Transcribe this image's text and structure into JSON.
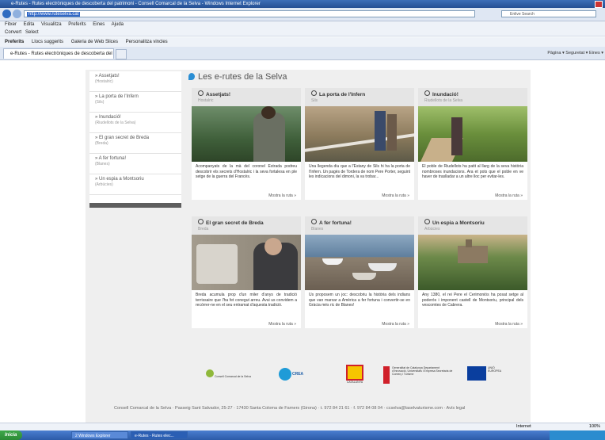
{
  "browser": {
    "title": "e-Rutes - Rutes electròniques de descoberta del patrimoni - Consell Comarcal de la Selva - Windows Internet Explorer",
    "address": "http://www.ruteselva.cat",
    "search_placeholder": "Enlive Search",
    "menu": [
      "Fitxer",
      "Edita",
      "Visualitza",
      "Preferits",
      "Eines",
      "Ajuda"
    ],
    "convert_label": "Convert",
    "select_label": "Select",
    "favorites_label": "Preferits",
    "fav_items": [
      "Llocs suggerits",
      "Galeria de Web Slices",
      "Personalitza vincles"
    ],
    "tab_label": "e-Rutes - Rutes electròniques de descoberta del patr...",
    "command_bar": "Pàgina ▾   Seguretat ▾   Eines ▾",
    "status_zone": "Internet",
    "status_zoom": "100%"
  },
  "sidebar": {
    "items": [
      {
        "title": "» Assetjats!",
        "sub": "(Hostalric)"
      },
      {
        "title": "» La porta de l'Infern",
        "sub": "(Sils)"
      },
      {
        "title": "» Inundació!",
        "sub": "(Riudellots de la Selva)"
      },
      {
        "title": "» El gran secret de Breda",
        "sub": "(Breda)"
      },
      {
        "title": "» A fer fortuna!",
        "sub": "(Blanes)"
      },
      {
        "title": "» Un espia a Montsoriu",
        "sub": "(Arbúcies)"
      }
    ]
  },
  "main": {
    "title": "Les e-rutes de la Selva",
    "cards": [
      {
        "title": "Assetjats!",
        "sub": "Hostalric",
        "desc": "Acompanyats de la mà del coronel Estrada podreu descobrir els secrets d'Hostalric i la seva fortalesa en ple setge de la guerra del Francès.",
        "more": "Mostra la ruta »"
      },
      {
        "title": "La porta de l'Infern",
        "sub": "Sils",
        "desc": "Una llegenda diu que a l'Estany de Sils hi ha la porta de l'Infern. Un pagès de Tordera de nom Pere Porter, seguint les indicacions del dimoni, la va trobar...",
        "more": "Mostra la ruta »"
      },
      {
        "title": "Inundació!",
        "sub": "Riudellots de la Selva",
        "desc": "El poble de Riudellots ha patit al llarg de la seva història nombroses inundacions. Ara et pots que el poble en ve haver de traslladar a un altre lloc per evitar-les.",
        "more": "Mostra la ruta »"
      },
      {
        "title": "El gran secret de Breda",
        "sub": "Breda",
        "desc": "Breda acumula prop d'un miler d'anys de tradició terrissaire que l'ha fet conegut arreu. Avui us convidem a recórrer-ne en el seu entramat d'aquesta tradició.",
        "more": "Mostra la ruta »"
      },
      {
        "title": "A fer fortuna!",
        "sub": "Blanes",
        "desc": "Us proposem un joc: descobriu la història dels indians que van marxar a Amèrica a fer fortuna i convertir-se en Gràcia més ric de Blanes!",
        "more": "Mostra la ruta »"
      },
      {
        "title": "Un espia a Montsoriu",
        "sub": "Arbúcies",
        "desc": "Any 1380, el rei Pere el Cerimoniós ha posat setge al poderós i imponent castell de Montsoriu, principal dels vescomtes de Cabrera.",
        "more": "Mostra la ruta »"
      }
    ]
  },
  "logos": [
    "Consell Comarcal de la Selva",
    "CREA",
    "CATALUNYA",
    "Generalitat de Catalunya Departament d'Innovació, Universitats i Empresa Secretaria de Comerç i Turisme",
    "UNIÓ EUROPEA"
  ],
  "footer": "Consell Comarcal de la Selva · Passeig Sant Salvador, 25-27 · 17430 Santa Coloma de Farners (Girona) · t. 972 84 21 61 · f. 972 84 08 04 · ccselva@laselvaturisme.com · Avís legal",
  "taskbar": {
    "start": "Inicia",
    "items": [
      "2 Windows Explorer",
      "e-Rutes - Rutes elec..."
    ]
  },
  "colors": {
    "accent": "#2a8ed4",
    "site_bg": "#efefef",
    "card_head": "#e5e5e5"
  }
}
